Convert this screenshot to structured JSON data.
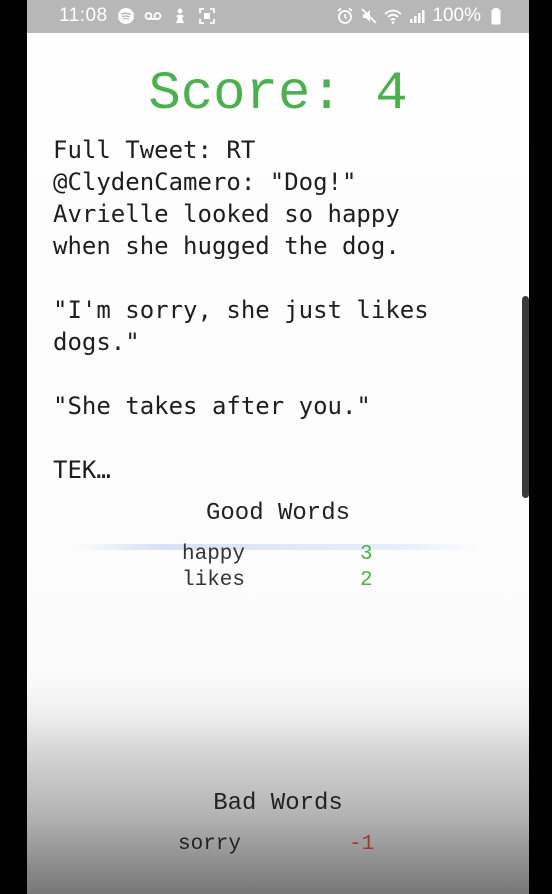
{
  "status_bar": {
    "time": "11:08",
    "battery_percent": "100%",
    "icons_left": [
      "spotify-icon",
      "voicemail-icon",
      "tasker-icon",
      "screenshot-icon"
    ],
    "icons_right": [
      "alarm-icon",
      "mute-icon",
      "wifi-icon",
      "signal-icon",
      "battery-icon"
    ]
  },
  "score": {
    "label": "Score:",
    "value": "4"
  },
  "tweet": {
    "text": "Full Tweet: RT\n@ClydenCamero: \"Dog!\"\nAvrielle looked so happy\nwhen she hugged the dog.\n\n\"I'm sorry, she just likes\ndogs.\"\n\n\"She takes after you.\"\n\nTEK…"
  },
  "good_words": {
    "title": "Good Words",
    "items": [
      {
        "word": "happy",
        "count": "3"
      },
      {
        "word": "likes",
        "count": "2"
      }
    ]
  },
  "bad_words": {
    "title": "Bad Words",
    "items": [
      {
        "word": "sorry",
        "count": "-1"
      }
    ]
  },
  "colors": {
    "score": "#4caf50",
    "good_count": "#4caf50",
    "bad_count": "#a03a2a",
    "status_bar": "#b7b7b7"
  }
}
